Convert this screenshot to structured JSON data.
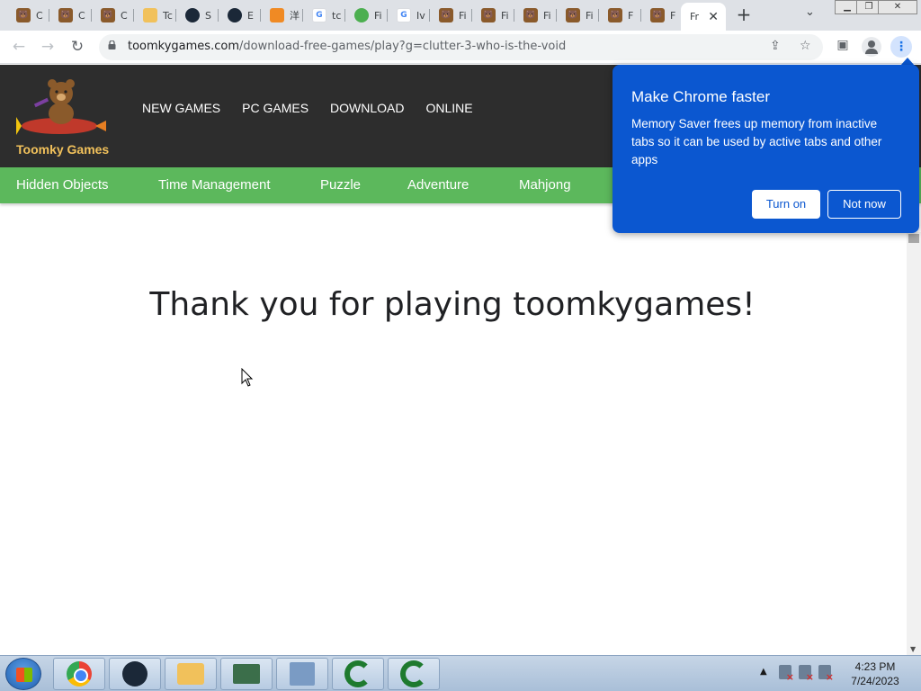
{
  "browser": {
    "tabs": [
      {
        "label": "C",
        "icon": "toomky-favicon"
      },
      {
        "label": "C",
        "icon": "toomky-favicon"
      },
      {
        "label": "C",
        "icon": "toomky-favicon"
      },
      {
        "label": "Tc",
        "icon": "folder-favicon"
      },
      {
        "label": "S",
        "icon": "steam-favicon"
      },
      {
        "label": "E",
        "icon": "steam-favicon"
      },
      {
        "label": "洋",
        "icon": "orange-favicon"
      },
      {
        "label": "tc",
        "icon": "google-favicon"
      },
      {
        "label": "Fi",
        "icon": "green-favicon"
      },
      {
        "label": "Iv",
        "icon": "google-favicon"
      },
      {
        "label": "Fi",
        "icon": "toomky-favicon"
      },
      {
        "label": "Fi",
        "icon": "toomky-favicon"
      },
      {
        "label": "Fi",
        "icon": "toomky-favicon"
      },
      {
        "label": "Fi",
        "icon": "toomky-favicon"
      },
      {
        "label": "F",
        "icon": "toomky-favicon"
      },
      {
        "label": "F",
        "icon": "toomky-favicon"
      },
      {
        "label": "Fr",
        "icon": "none",
        "active": true
      }
    ],
    "new_tab": "+",
    "url_domain": "toomkygames.com",
    "url_path": "/download-free-games/play?g=clutter-3-who-is-the-void"
  },
  "site": {
    "logo_text": "Toomky Games",
    "main_nav": [
      "NEW GAMES",
      "PC GAMES",
      "DOWNLOAD",
      "ONLINE"
    ],
    "categories": [
      "Hidden Objects",
      "Time Management",
      "Puzzle",
      "Adventure",
      "Mahjong"
    ],
    "thanks": "Thank you for playing toomkygames!"
  },
  "bubble": {
    "title": "Make Chrome faster",
    "body": "Memory Saver frees up memory from inactive tabs so it can be used by active tabs and other apps",
    "turn_on": "Turn on",
    "not_now": "Not now"
  },
  "taskbar": {
    "time": "4:23 PM",
    "date": "7/24/2023"
  },
  "colors": {
    "header_bg": "#2d2d2d",
    "category_bar": "#5cb85c",
    "bubble_bg": "#0b57d0",
    "logo_text": "#f1c15b"
  }
}
